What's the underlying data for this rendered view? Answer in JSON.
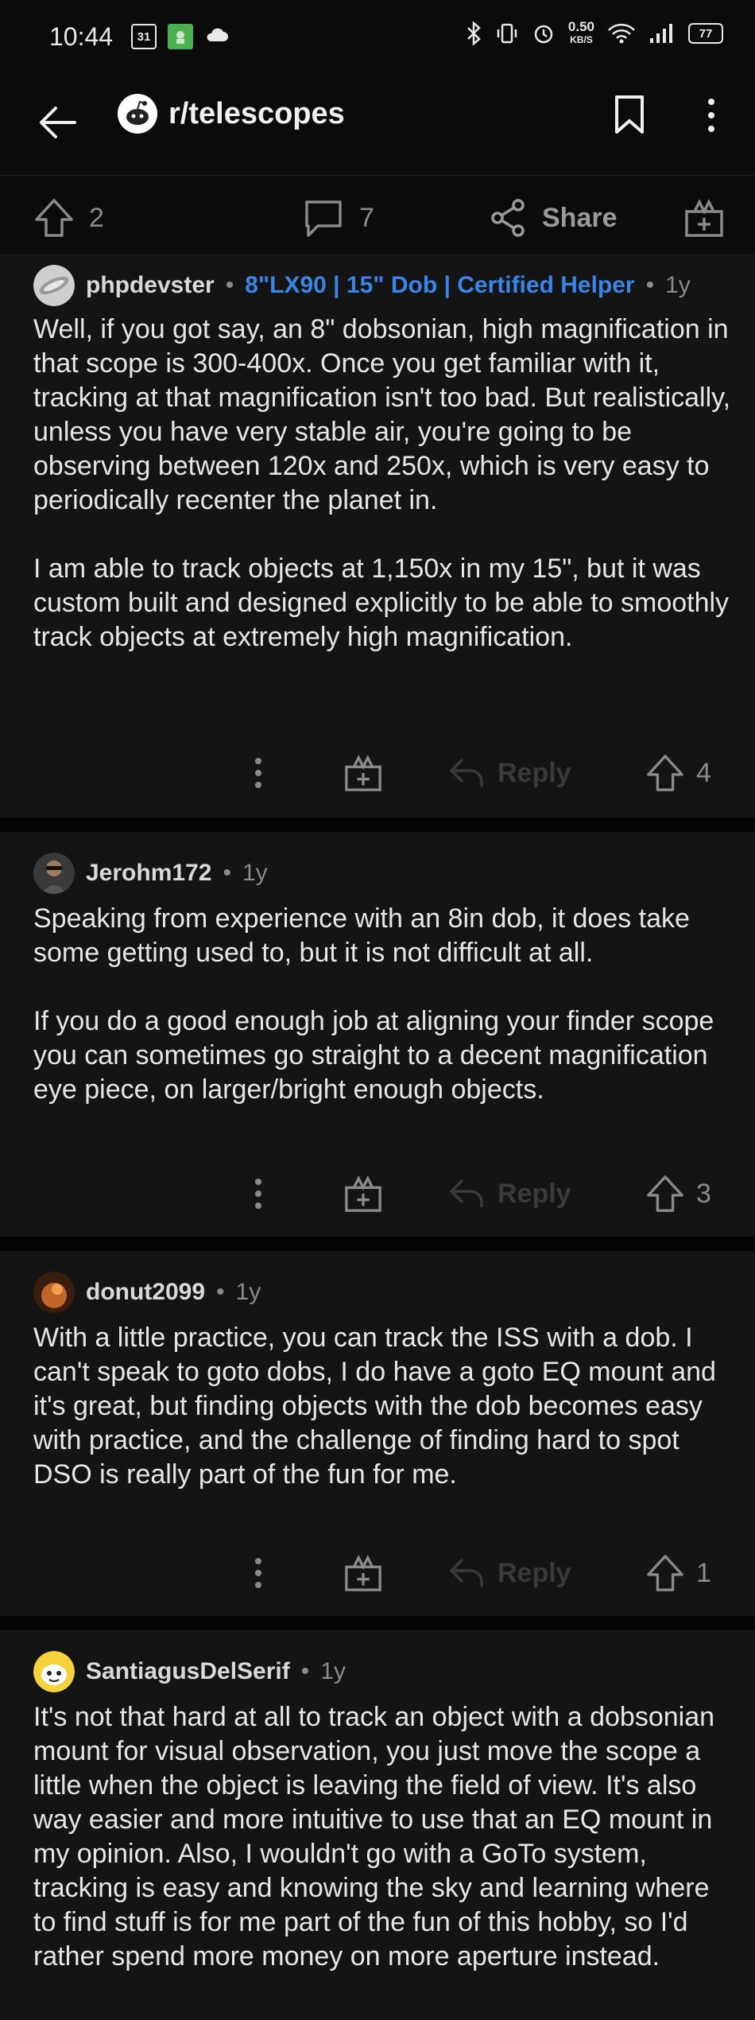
{
  "status_bar": {
    "time": "10:44",
    "calendar_day": "31",
    "net_speed_value": "0.50",
    "net_speed_unit": "KB/S",
    "battery": "77"
  },
  "header": {
    "subreddit": "r/telescopes"
  },
  "post_actions": {
    "upvotes": "2",
    "comments": "7",
    "share_label": "Share"
  },
  "comments": [
    {
      "username": "phpdevster",
      "flair": "8\"LX90 | 15\" Dob | Certified Helper",
      "time": "1y",
      "paragraphs": [
        "Well, if you got say, an 8\" dobsonian, high magnification in that scope is 300-400x. Once you get familiar with it, tracking at that magnification isn't too bad. But realistically, unless you have very stable air, you're going to be observing between 120x and 250x, which is very easy to periodically recenter the planet in.",
        "I am able to track objects at 1,150x in my 15\", but it was custom built and designed explicitly to be able to smoothly track objects at extremely high magnification."
      ],
      "reply_label": "Reply",
      "votes": "4"
    },
    {
      "username": "Jerohm172",
      "time": "1y",
      "paragraphs": [
        "Speaking from experience with an 8in dob, it does take some getting used to, but it is not difficult at all.",
        "If you do a good enough job at aligning your finder scope you can sometimes go straight to a decent magnification eye piece, on larger/bright enough objects."
      ],
      "reply_label": "Reply",
      "votes": "3"
    },
    {
      "username": "donut2099",
      "time": "1y",
      "paragraphs": [
        "With a little practice, you can track the ISS with a dob. I can't speak to goto dobs, I do have a goto EQ mount and it's great, but finding objects with the dob becomes easy with practice, and the challenge of finding hard to spot DSO is really part of the fun for me."
      ],
      "reply_label": "Reply",
      "votes": "1"
    },
    {
      "username": "SantiagusDelSerif",
      "time": "1y",
      "paragraphs": [
        "It's not that hard at all to track an object with a dobsonian mount for visual observation, you just move the scope a little when the object is leaving the field of view. It's also way easier and more intuitive to use that an EQ mount in my opinion. Also, I wouldn't go with a GoTo system, tracking is easy and knowing the sky and learning where to find stuff is for me part of the fun of this hobby, so I'd rather spend more money on more aperture instead."
      ]
    }
  ]
}
